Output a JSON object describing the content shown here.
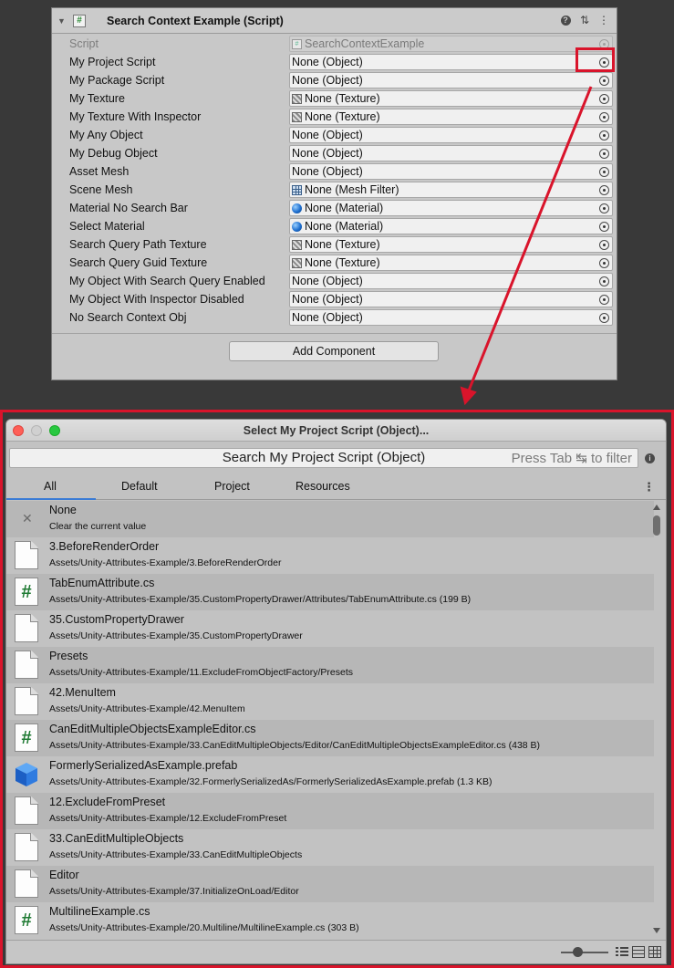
{
  "inspector": {
    "component_title": "Search Context Example (Script)",
    "header_icons": [
      "help-icon",
      "preset-icon",
      "more-icon"
    ],
    "properties": [
      {
        "label": "Script",
        "value": "SearchContextExample",
        "icon": "script-icon",
        "disabled": true
      },
      {
        "label": "My Project Script",
        "value": "None (Object)",
        "icon": ""
      },
      {
        "label": "My Package Script",
        "value": "None (Object)",
        "icon": ""
      },
      {
        "label": "My Texture",
        "value": "None (Texture)",
        "icon": "texture-icon"
      },
      {
        "label": "My Texture With Inspector",
        "value": "None (Texture)",
        "icon": "texture-icon"
      },
      {
        "label": "My Any Object",
        "value": "None (Object)",
        "icon": ""
      },
      {
        "label": "My Debug Object",
        "value": "None (Object)",
        "icon": ""
      },
      {
        "label": "Asset Mesh",
        "value": "None (Object)",
        "icon": ""
      },
      {
        "label": "Scene Mesh",
        "value": "None (Mesh Filter)",
        "icon": "mesh-filter-icon"
      },
      {
        "label": "Material No Search Bar",
        "value": "None (Material)",
        "icon": "material-icon"
      },
      {
        "label": "Select Material",
        "value": "None (Material)",
        "icon": "material-icon"
      },
      {
        "label": "Search Query Path Texture",
        "value": "None (Texture)",
        "icon": "texture-icon"
      },
      {
        "label": "Search Query Guid Texture",
        "value": "None (Texture)",
        "icon": "texture-icon"
      },
      {
        "label": "My Object With Search Query Enabled",
        "value": "None (Object)",
        "icon": ""
      },
      {
        "label": "My Object With Inspector Disabled",
        "value": "None (Object)",
        "icon": ""
      },
      {
        "label": "No Search Context Obj",
        "value": "None (Object)",
        "icon": ""
      }
    ],
    "add_component_label": "Add Component",
    "highlight_color": "#d9142b"
  },
  "picker_window": {
    "title": "Select My Project Script (Object)...",
    "search_value": "Search My Project Script (Object)",
    "search_hint": "Press Tab ↹ to filter",
    "tabs": [
      "All",
      "Default",
      "Project",
      "Resources"
    ],
    "active_tab": "All",
    "accent_color": "#3a7bd5",
    "results": [
      {
        "name": "None",
        "path": "Clear the current value",
        "icon": "close-icon"
      },
      {
        "name": "3.BeforeRenderOrder",
        "path": "Assets/Unity-Attributes-Example/3.BeforeRenderOrder",
        "icon": "folder-file-icon"
      },
      {
        "name": "TabEnumAttribute.cs",
        "path": "Assets/Unity-Attributes-Example/35.CustomPropertyDrawer/Attributes/TabEnumAttribute.cs (199 B)",
        "icon": "csharp-script-icon"
      },
      {
        "name": "35.CustomPropertyDrawer",
        "path": "Assets/Unity-Attributes-Example/35.CustomPropertyDrawer",
        "icon": "folder-file-icon"
      },
      {
        "name": "Presets",
        "path": "Assets/Unity-Attributes-Example/11.ExcludeFromObjectFactory/Presets",
        "icon": "folder-file-icon"
      },
      {
        "name": "42.MenuItem",
        "path": "Assets/Unity-Attributes-Example/42.MenuItem",
        "icon": "folder-file-icon"
      },
      {
        "name": "CanEditMultipleObjectsExampleEditor.cs",
        "path": "Assets/Unity-Attributes-Example/33.CanEditMultipleObjects/Editor/CanEditMultipleObjectsExampleEditor.cs (438 B)",
        "icon": "csharp-script-icon"
      },
      {
        "name": "FormerlySerializedAsExample.prefab",
        "path": "Assets/Unity-Attributes-Example/32.FormerlySerializedAs/FormerlySerializedAsExample.prefab (1.3 KB)",
        "icon": "prefab-icon"
      },
      {
        "name": "12.ExcludeFromPreset",
        "path": "Assets/Unity-Attributes-Example/12.ExcludeFromPreset",
        "icon": "folder-file-icon"
      },
      {
        "name": "33.CanEditMultipleObjects",
        "path": "Assets/Unity-Attributes-Example/33.CanEditMultipleObjects",
        "icon": "folder-file-icon"
      },
      {
        "name": "Editor",
        "path": "Assets/Unity-Attributes-Example/37.InitializeOnLoad/Editor",
        "icon": "folder-file-icon"
      },
      {
        "name": "MultilineExample.cs",
        "path": "Assets/Unity-Attributes-Example/20.Multiline/MultilineExample.cs (303 B)",
        "icon": "csharp-script-icon"
      }
    ],
    "view_modes": [
      "list-view-icon",
      "details-view-icon",
      "grid-view-icon"
    ]
  }
}
